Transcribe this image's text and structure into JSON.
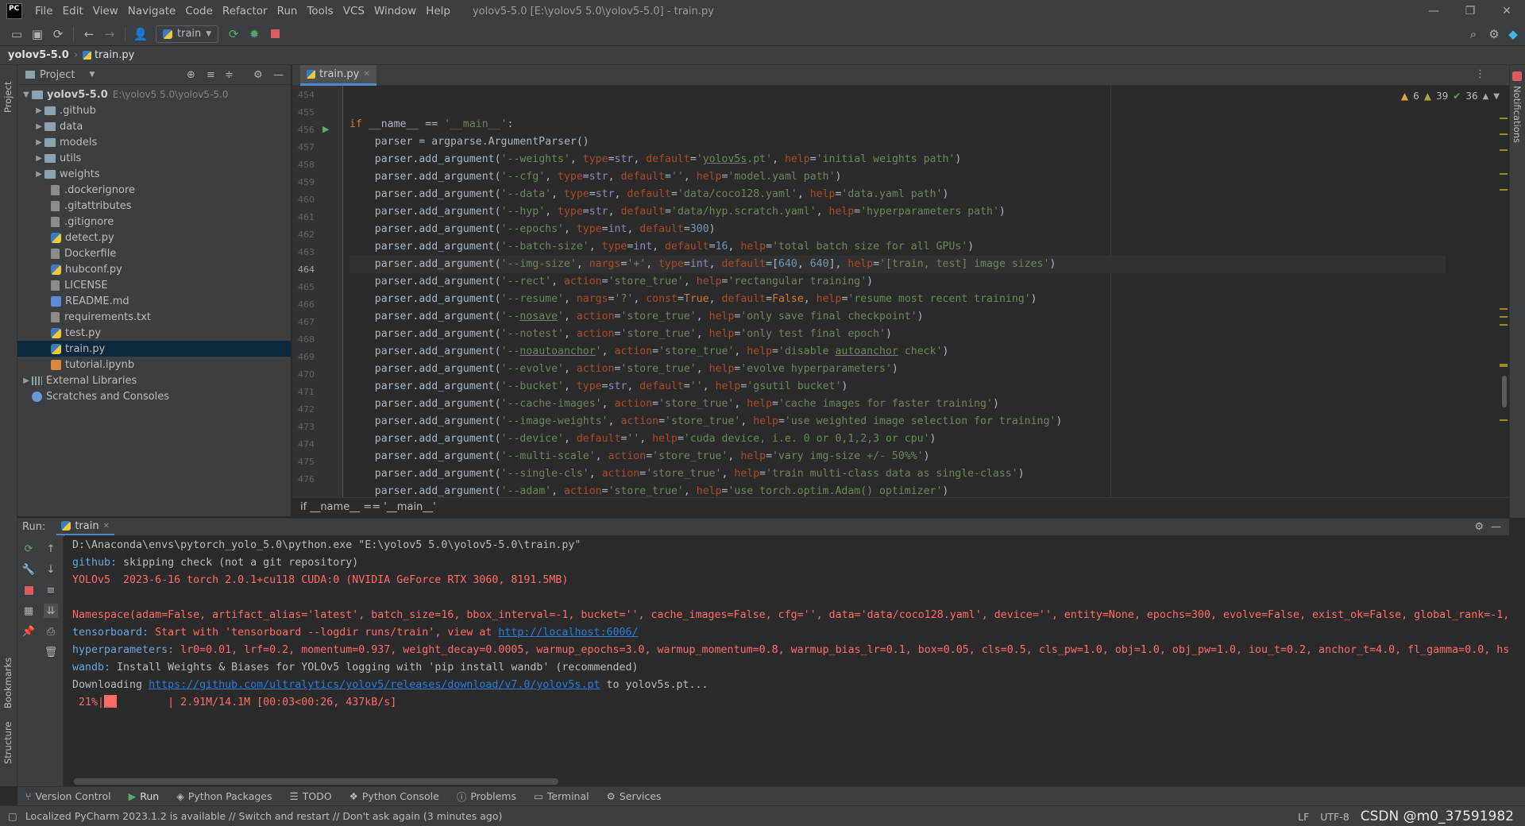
{
  "app": {
    "logo_text": "PC",
    "window_title": "yolov5-5.0 [E:\\yolov5 5.0\\yolov5-5.0] - train.py"
  },
  "menu": [
    "File",
    "Edit",
    "View",
    "Navigate",
    "Code",
    "Refactor",
    "Run",
    "Tools",
    "VCS",
    "Window",
    "Help"
  ],
  "toolbar": {
    "run_config": "train"
  },
  "navbar": {
    "project": "yolov5-5.0",
    "file": "train.py"
  },
  "left_strip": {
    "project_label": "Project",
    "bookmarks_label": "Bookmarks",
    "structure_label": "Structure"
  },
  "right_strip": {
    "notifications_label": "Notifications"
  },
  "project_panel": {
    "title": "Project",
    "root_name": "yolov5-5.0",
    "root_path": "E:\\yolov5 5.0\\yolov5-5.0",
    "folders": [
      ".github",
      "data",
      "models",
      "utils",
      "weights"
    ],
    "files": [
      ".dockerignore",
      ".gitattributes",
      ".gitignore",
      "detect.py",
      "Dockerfile",
      "hubconf.py",
      "LICENSE",
      "README.md",
      "requirements.txt",
      "test.py",
      "train.py",
      "tutorial.ipynb"
    ],
    "external_libraries": "External Libraries",
    "scratches": "Scratches and Consoles"
  },
  "editor": {
    "tab_label": "train.py",
    "breadcrumb": "if __name__ == '__main__'",
    "inspections": {
      "warnings": "6",
      "weak_warnings": "39",
      "typos": "36"
    },
    "line_numbers": [
      "454",
      "455",
      "456",
      "457",
      "458",
      "459",
      "460",
      "461",
      "462",
      "463",
      "464",
      "465",
      "466",
      "467",
      "468",
      "469",
      "470",
      "471",
      "472",
      "473",
      "474",
      "475",
      "476"
    ],
    "current_line": "464"
  },
  "run_panel": {
    "label": "Run:",
    "tab": "train",
    "console": {
      "line1": "D:\\Anaconda\\envs\\pytorch_yolo_5.0\\python.exe \"E:\\yolov5 5.0\\yolov5-5.0\\train.py\"",
      "line2_prefix": "github: ",
      "line2_text": "skipping check (not a git repository)",
      "line3": "YOLOv5  2023-6-16 torch 2.0.1+cu118 CUDA:0 (NVIDIA GeForce RTX 3060, 8191.5MB)",
      "line4": "Namespace(adam=False, artifact_alias='latest', batch_size=16, bbox_interval=-1, bucket='', cache_images=False, cfg='', data='data/coco128.yaml', device='', entity=None, epochs=300, evolve=False, exist_ok=False, global_rank=-1,",
      "line5_prefix": "tensorboard: ",
      "line5_text": "Start with 'tensorboard --logdir runs/train', view at ",
      "line5_link": "http://localhost:6006/",
      "line6_prefix": "hyperparameters: ",
      "line6_text": "lr0=0.01, lrf=0.2, momentum=0.937, weight_decay=0.0005, warmup_epochs=3.0, warmup_momentum=0.8, warmup_bias_lr=0.1, box=0.05, cls=0.5, cls_pw=1.0, obj=1.0, obj_pw=1.0, iou_t=0.2, anchor_t=4.0, fl_gamma=0.0, hs",
      "line7_prefix": "wandb: ",
      "line7_text": "Install Weights & Biases for YOLOv5 logging with 'pip install wandb' (recommended)",
      "line8_text": "Downloading ",
      "line8_link": "https://github.com/ultralytics/yolov5/releases/download/v7.0/yolov5s.pt",
      "line8_suffix": " to yolov5s.pt...",
      "progress_percent": " 21%|",
      "progress_rest": "        | 2.91M/14.1M [00:03<00:26, 437kB/s]",
      "progress_fraction": 0.21
    }
  },
  "tool_windows": [
    "Version Control",
    "Run",
    "Python Packages",
    "TODO",
    "Python Console",
    "Problems",
    "Terminal",
    "Services"
  ],
  "status_bar": {
    "message": "Localized PyCharm 2023.1.2 is available // Switch and restart // Don't ask again (3 minutes ago)",
    "line_sep": "LF",
    "encoding": "UTF-8",
    "watermark": "CSDN @m0_37591982"
  }
}
